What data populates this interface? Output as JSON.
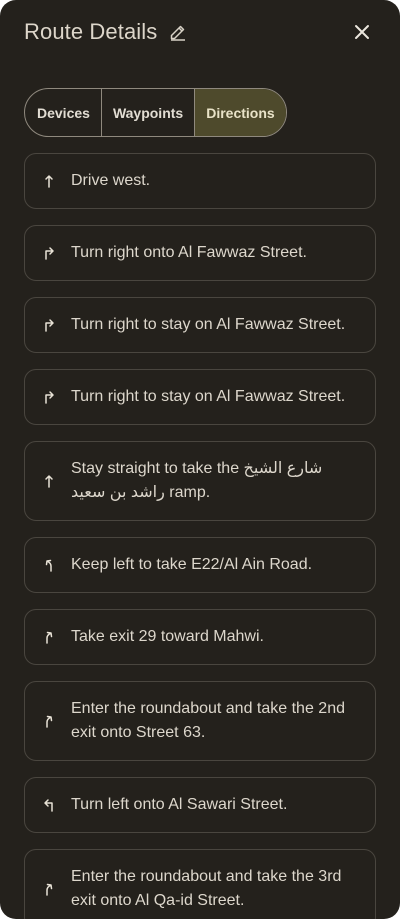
{
  "header": {
    "title": "Route Details"
  },
  "tabs": [
    {
      "label": "Devices",
      "active": false
    },
    {
      "label": "Waypoints",
      "active": false
    },
    {
      "label": "Directions",
      "active": true
    }
  ],
  "steps": [
    {
      "icon": "straight-arrow-icon",
      "text": "Drive west."
    },
    {
      "icon": "turn-right-icon",
      "text": "Turn right onto Al Fawwaz Street."
    },
    {
      "icon": "turn-right-icon",
      "text": "Turn right to stay on Al Fawwaz Street."
    },
    {
      "icon": "turn-right-icon",
      "text": "Turn right to stay on Al Fawwaz Street."
    },
    {
      "icon": "straight-arrow-icon",
      "text": "Stay straight to take the شارع الشيخ راشد بن سعيد ramp."
    },
    {
      "icon": "keep-left-icon",
      "text": "Keep left to take E22/Al Ain Road."
    },
    {
      "icon": "slight-right-icon",
      "text": "Take exit 29 toward Mahwi."
    },
    {
      "icon": "slight-right-icon",
      "text": "Enter the roundabout and take the 2nd exit onto Street 63."
    },
    {
      "icon": "turn-left-icon",
      "text": "Turn left onto Al Sawari Street."
    },
    {
      "icon": "slight-right-icon",
      "text": "Enter the roundabout and take the 3rd exit onto Al Qa-id Street."
    }
  ],
  "colors": {
    "panel_bg": "#24211c",
    "active_tab_bg": "#4e4a2c",
    "card_border": "#4a463f"
  }
}
